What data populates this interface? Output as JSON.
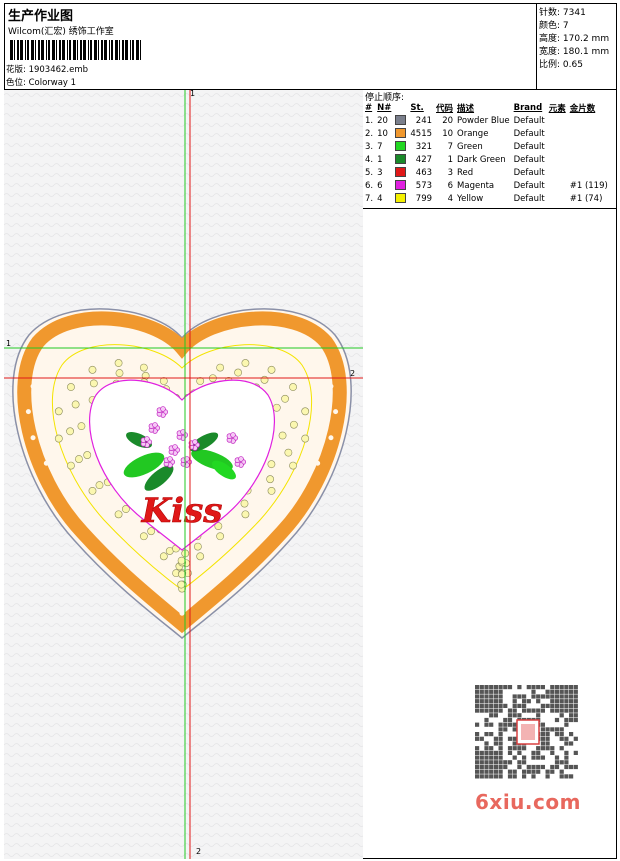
{
  "header": {
    "title": "生产作业图",
    "company": "Wilcom(汇宏) 绣饰工作室",
    "design_label": "花版:",
    "design_value": "1903462.emb",
    "colorway_label": "色位:",
    "colorway_value": "Colorway 1"
  },
  "stats": [
    {
      "label": "针数",
      "value": "7341"
    },
    {
      "label": "颜色",
      "value": "7"
    },
    {
      "label": "高度",
      "value": "170.2 mm"
    },
    {
      "label": "宽度",
      "value": "180.1 mm"
    },
    {
      "label": "比例",
      "value": "0.65"
    }
  ],
  "stop_sequence": {
    "title": "停止顺序:",
    "columns": [
      "#",
      "N#",
      "St.",
      "代码",
      "描述",
      "Brand",
      "元素",
      "金片数"
    ],
    "rows": [
      {
        "idx": "1.",
        "n": "20",
        "color": "#7a7f8c",
        "st": "241",
        "code": "20",
        "desc": "Powder Blue",
        "brand": "Default",
        "elem": "",
        "sequin": ""
      },
      {
        "idx": "2.",
        "n": "10",
        "color": "#f0982e",
        "st": "4515",
        "code": "10",
        "desc": "Orange",
        "brand": "Default",
        "elem": "",
        "sequin": ""
      },
      {
        "idx": "3.",
        "n": "7",
        "color": "#22d822",
        "st": "321",
        "code": "7",
        "desc": "Green",
        "brand": "Default",
        "elem": "",
        "sequin": ""
      },
      {
        "idx": "4.",
        "n": "1",
        "color": "#1a8a2a",
        "st": "427",
        "code": "1",
        "desc": "Dark Green",
        "brand": "Default",
        "elem": "",
        "sequin": ""
      },
      {
        "idx": "5.",
        "n": "3",
        "color": "#e01818",
        "st": "463",
        "code": "3",
        "desc": "Red",
        "brand": "Default",
        "elem": "",
        "sequin": ""
      },
      {
        "idx": "6.",
        "n": "6",
        "color": "#e020e0",
        "st": "573",
        "code": "6",
        "desc": "Magenta",
        "brand": "Default",
        "elem": "",
        "sequin": "#1 (119)"
      },
      {
        "idx": "7.",
        "n": "4",
        "color": "#f4f000",
        "st": "799",
        "code": "4",
        "desc": "Yellow",
        "brand": "Default",
        "elem": "",
        "sequin": "#1 (74)"
      }
    ]
  },
  "design": {
    "text": "Kiss",
    "markers": {
      "top": "1",
      "left": "1",
      "right": "2",
      "bottom": "2"
    }
  },
  "watermark": {
    "text": "6xiu.com"
  }
}
